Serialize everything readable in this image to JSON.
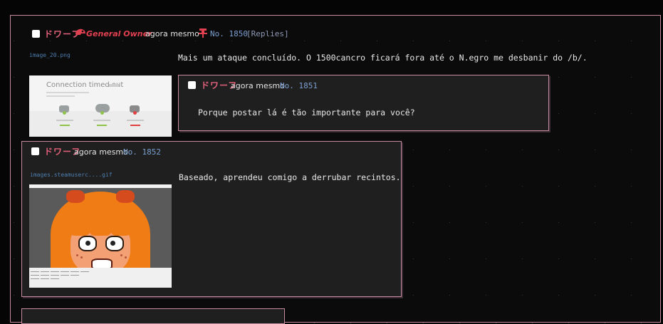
{
  "thread": {
    "name": "ドワーフ",
    "capcode": "General Owner",
    "date": "agora mesmo",
    "post_no": "No. 1850",
    "replies_link": "[Replies]",
    "file_name": "image_20.png",
    "message": "Mais um ataque concluído. O 1500cancro ficará fora até o N.egro me desbanir do /b/.",
    "thumbnail": {
      "title": "Connection timed out"
    }
  },
  "replies": [
    {
      "name": "ドワーフ",
      "date": "agora mesmo",
      "post_no": "No. 1851",
      "message": "Porque postar lá é tão importante para você?"
    },
    {
      "name": "ドワーフ",
      "date": "agora mesmo",
      "post_no": "No. 1852",
      "file_name": "images.steamuserc....gif",
      "message": "Baseado, aprendeu comigo a derrubar recintos."
    }
  ],
  "icons": {
    "capcode": "crown-cap-icon",
    "pin": "pin-icon"
  },
  "colors": {
    "name": "#e0607a",
    "capcode": "#e0404f",
    "post_number": "#7b9fd0",
    "border": "#c78aa0",
    "background": "#050505",
    "reply_background": "#1f1f1f"
  }
}
